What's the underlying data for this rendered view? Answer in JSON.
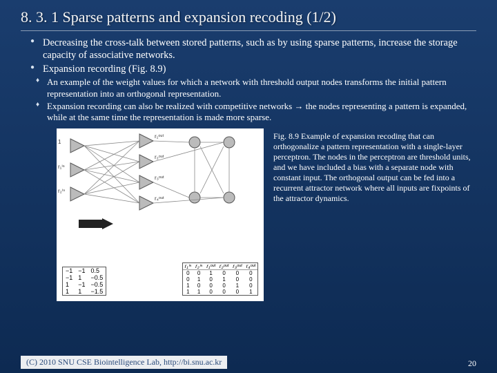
{
  "title": "8. 3. 1 Sparse patterns and expansion recoding (1/2)",
  "bullets": {
    "b1": "Decreasing the cross-talk between stored patterns, such as by using sparse patterns, increase the storage capacity of associative networks.",
    "b2": "Expansion recording (Fig. 8.9)",
    "s1": "An example of the weight values for which a network with threshold output nodes transforms the initial pattern representation into an orthogonal representation.",
    "s2": "Expansion recording can also be realized with competitive networks → the nodes representing a pattern is expanded, while at the same time the representation is made more sparse."
  },
  "caption": "Fig. 8.9 Example of expansion recoding that can orthogonalize a pattern representation with a single-layer perceptron. The nodes in the perceptron are threshold units, and we have included a bias with a separate node with constant input. The orthogonal output can be fed into a recurrent attractor network where all inputs are fixpoints of the attractor dynamics.",
  "labels": {
    "r1in": "r₁ⁱⁿ",
    "r2in": "r₂ⁱⁿ",
    "rout1": "r₁ᵒᵘᵗ",
    "rout2": "r₂ᵒᵘᵗ",
    "rout3": "r₃ᵒᵘᵗ",
    "rout4": "r₄ᵒᵘᵗ",
    "one": "1"
  },
  "matrix": {
    "rows": [
      [
        "−1",
        "−1",
        "0.5"
      ],
      [
        "−1",
        "1",
        "−0.5"
      ],
      [
        "1",
        "−1",
        "−0.5"
      ],
      [
        "1",
        "1",
        "−1.5"
      ]
    ]
  },
  "truth": {
    "headers": [
      "r₁ⁱⁿ",
      "r₂ⁱⁿ",
      "r₁ᵒᵘᵗ",
      "r₂ᵒᵘᵗ",
      "r₃ᵒᵘᵗ",
      "r₄ᵒᵘᵗ"
    ],
    "rows": [
      [
        "0",
        "0",
        "1",
        "0",
        "0",
        "0"
      ],
      [
        "0",
        "1",
        "0",
        "1",
        "0",
        "0"
      ],
      [
        "1",
        "0",
        "0",
        "0",
        "1",
        "0"
      ],
      [
        "1",
        "1",
        "0",
        "0",
        "0",
        "1"
      ]
    ]
  },
  "footer": {
    "left": "(C) 2010 SNU CSE Biointelligence Lab,   http://bi.snu.ac.kr",
    "right": "20"
  }
}
